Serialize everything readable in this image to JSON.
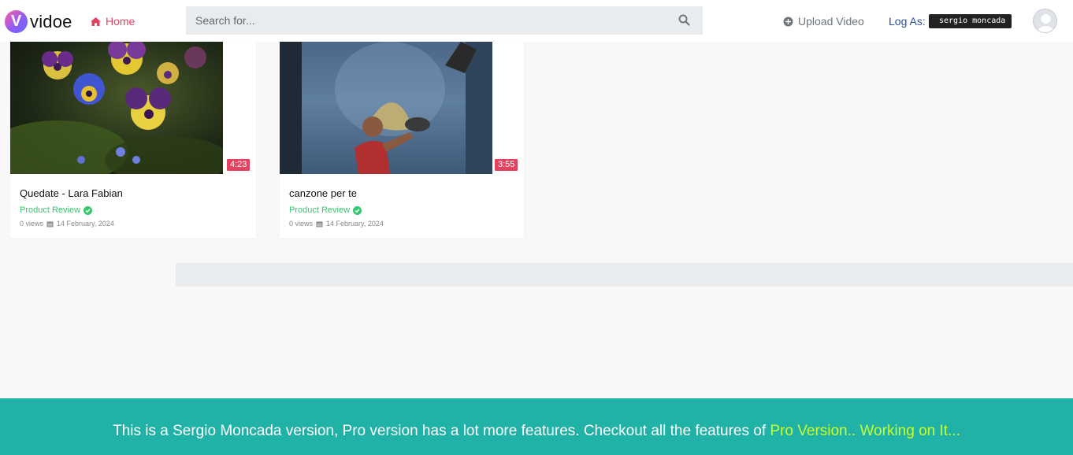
{
  "header": {
    "logo_letter": "V",
    "logo_text": "vidoe",
    "home_label": "Home",
    "search_placeholder": "Search for...",
    "upload_label": "Upload Video",
    "logas_label": "Log As:",
    "username": "sergio moncada"
  },
  "videos": [
    {
      "title": "Quedate - Lara Fabian",
      "channel": "Product Review",
      "views": "0 views",
      "date": "14 February, 2024",
      "duration": "4:23"
    },
    {
      "title": "canzone per te",
      "channel": "Product Review",
      "views": "0 views",
      "date": "14 February, 2024",
      "duration": "3:55"
    }
  ],
  "footer": {
    "text": "This is a Sergio Moncada version, Pro version has a lot more features. Checkout all the features of ",
    "link": "Pro Version.. Working on It..."
  },
  "colors": {
    "accent": "#e4405f",
    "verified": "#35c66e",
    "footer_bg": "#20b2a6",
    "footer_link": "#c8ff2a"
  }
}
